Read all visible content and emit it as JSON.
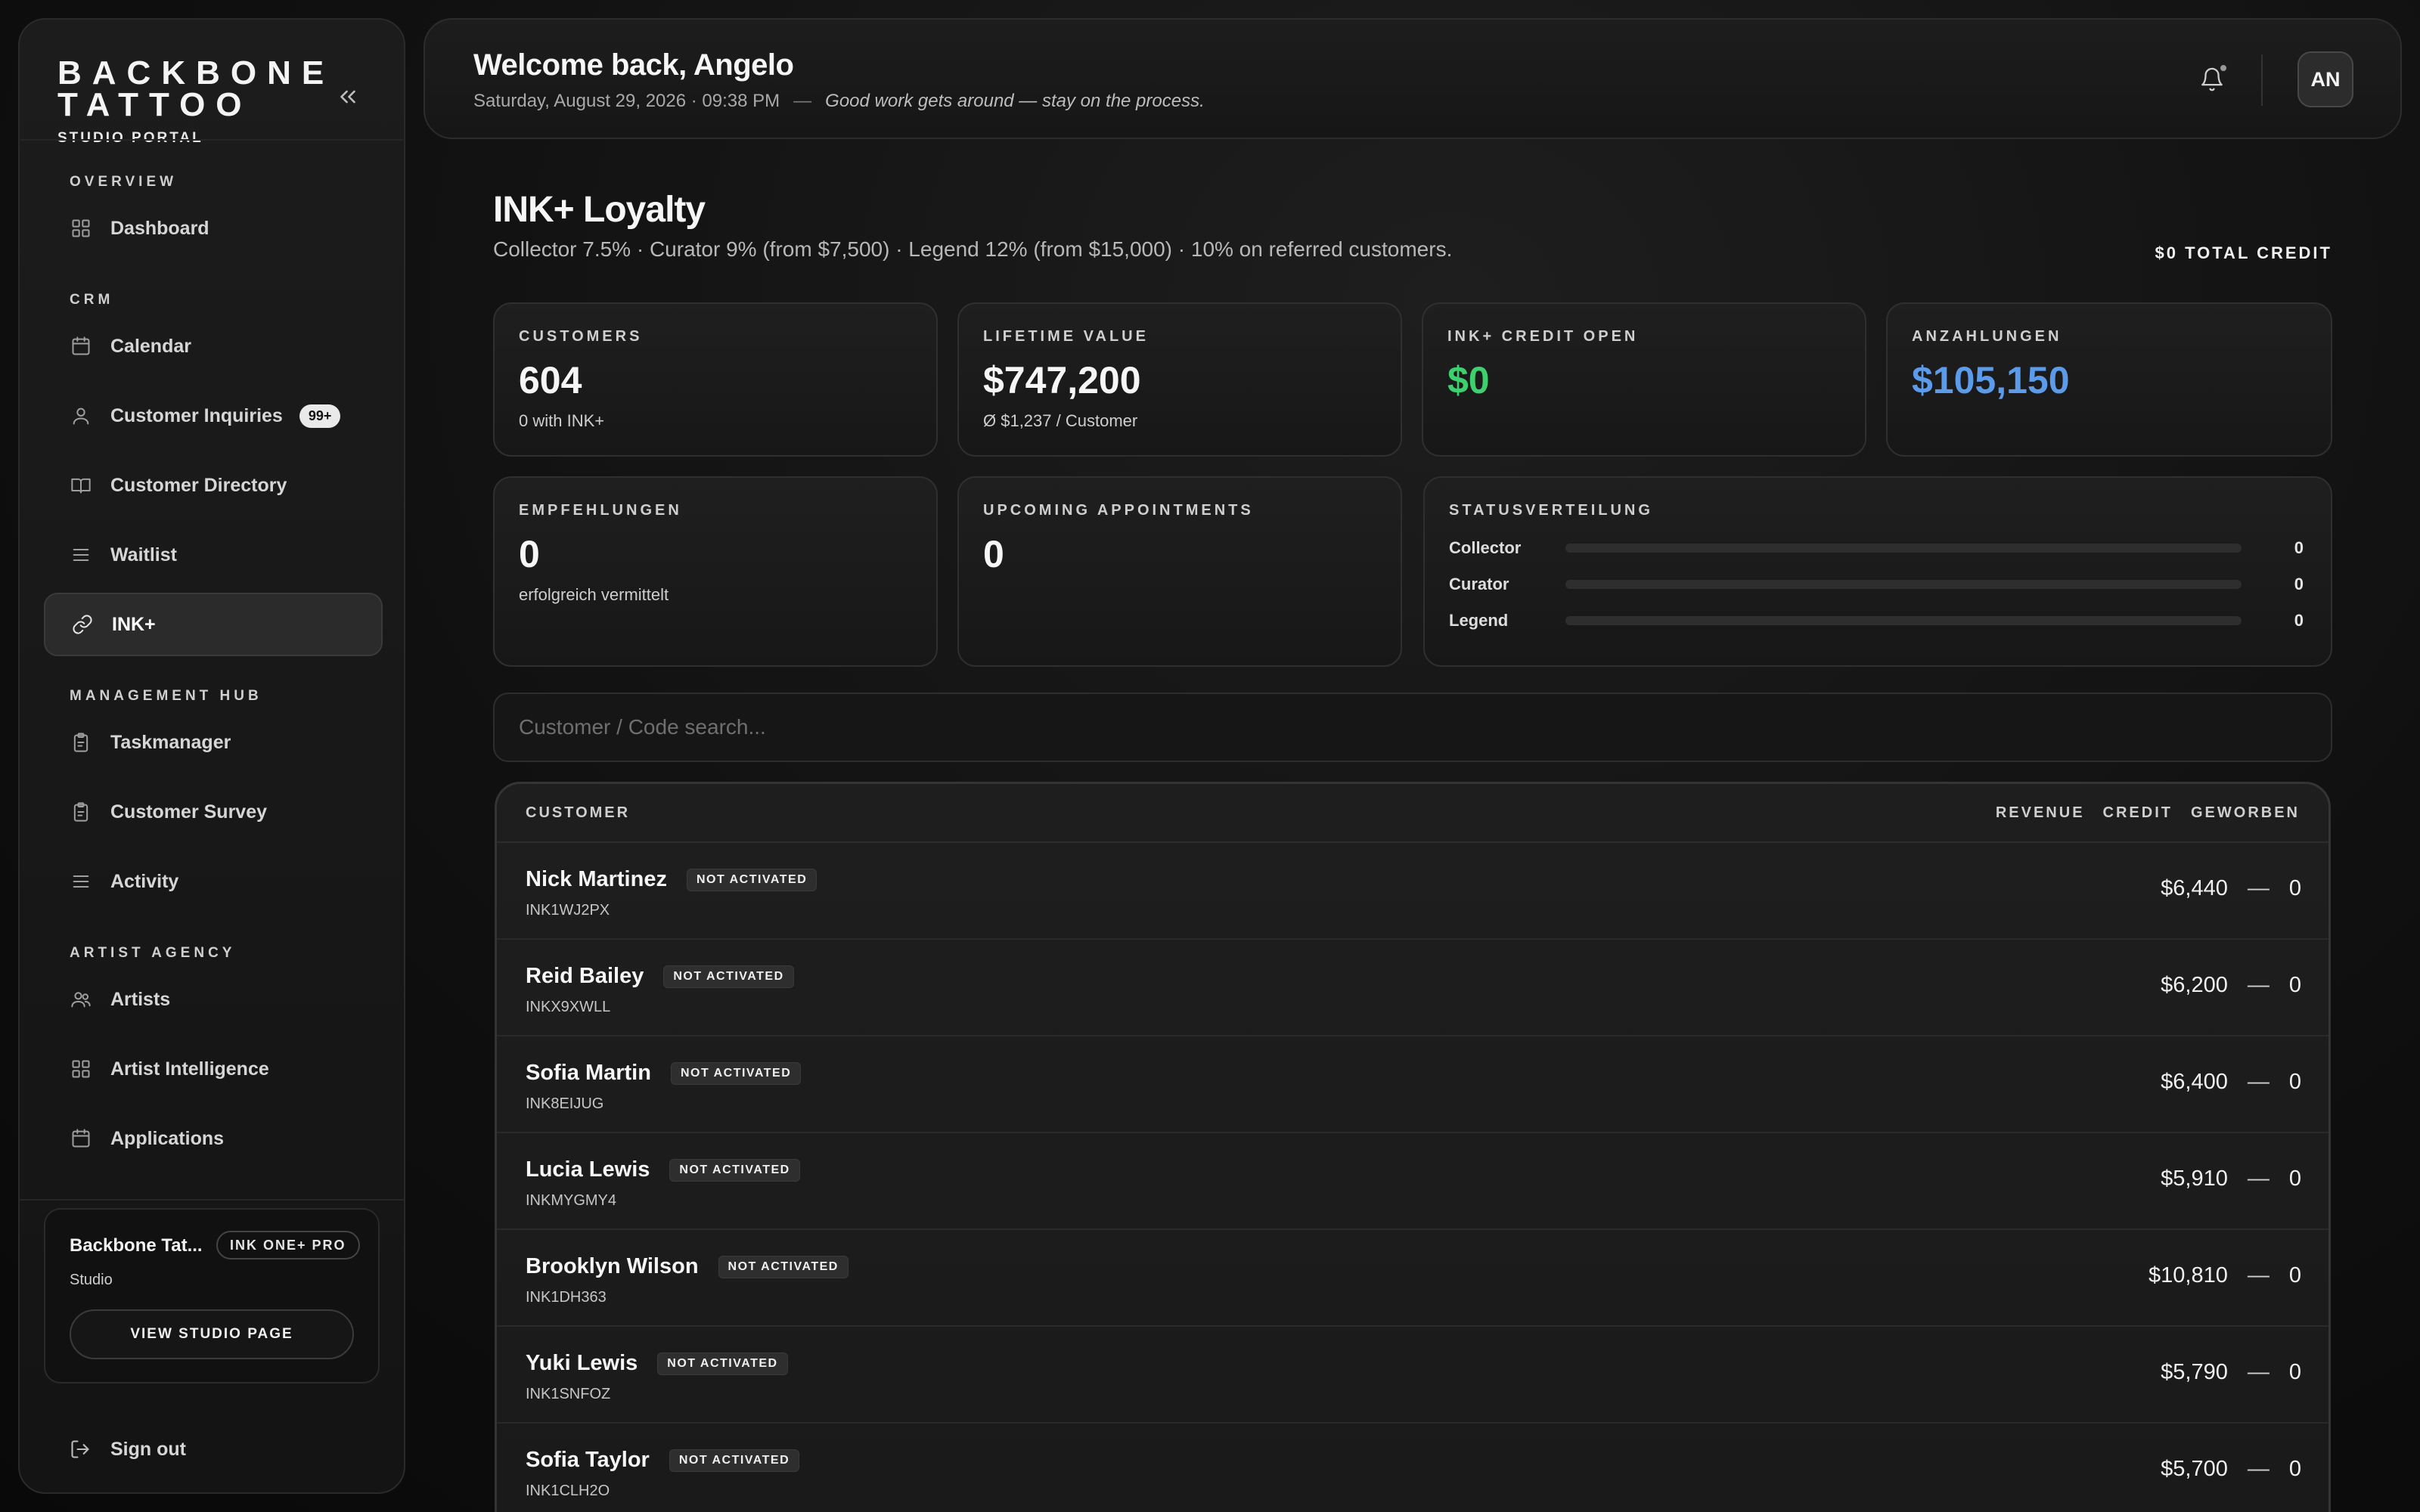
{
  "brand": {
    "line1": "BACKBONE",
    "line2": "TATTOO",
    "subtitle": "STUDIO PORTAL"
  },
  "sidebar": {
    "sections": [
      {
        "title": "OVERVIEW",
        "items": [
          {
            "label": "Dashboard",
            "icon": "grid-icon"
          }
        ]
      },
      {
        "title": "CRM",
        "items": [
          {
            "label": "Calendar",
            "icon": "calendar-icon"
          },
          {
            "label": "Customer Inquiries",
            "icon": "user-icon",
            "badge": "99+"
          },
          {
            "label": "Customer Directory",
            "icon": "book-icon"
          },
          {
            "label": "Waitlist",
            "icon": "list-icon"
          },
          {
            "label": "INK+",
            "icon": "link-icon",
            "active": true
          }
        ]
      },
      {
        "title": "MANAGEMENT HUB",
        "items": [
          {
            "label": "Taskmanager",
            "icon": "clipboard-icon"
          },
          {
            "label": "Customer Survey",
            "icon": "clipboard-icon"
          },
          {
            "label": "Activity",
            "icon": "list-icon"
          }
        ]
      },
      {
        "title": "ARTIST AGENCY",
        "items": [
          {
            "label": "Artists",
            "icon": "users-icon"
          },
          {
            "label": "Artist Intelligence",
            "icon": "grid-icon"
          },
          {
            "label": "Applications",
            "icon": "calendar-icon"
          }
        ]
      }
    ],
    "studio": {
      "name": "Backbone Tat...",
      "plan": "INK ONE+ PRO",
      "type": "Studio",
      "button": "VIEW STUDIO PAGE"
    },
    "signout": "Sign out"
  },
  "header": {
    "welcome": "Welcome back, Angelo",
    "datetime": "Saturday, August 29, 2026 · 09:38 PM",
    "separator": "—",
    "quote": "Good work gets around — stay on the process.",
    "avatar": "AN"
  },
  "main": {
    "title": "INK+ Loyalty",
    "description": "Collector 7.5% · Curator 9% (from $7,500) · Legend 12% (from $15,000) · 10% on referred customers.",
    "total_credit": "$0 TOTAL CREDIT",
    "stats": [
      {
        "label": "CUSTOMERS",
        "value": "604",
        "sub": "0 with INK+"
      },
      {
        "label": "LIFETIME VALUE",
        "value": "$747,200",
        "sub": "Ø $1,237 / Customer"
      },
      {
        "label": "INK+ CREDIT OPEN",
        "value": "$0",
        "sub": "",
        "color": "#3ecf6e"
      },
      {
        "label": "ANZAHLUNGEN",
        "value": "$105,150",
        "sub": "",
        "color": "#5b9bea"
      },
      {
        "label": "EMPFEHLUNGEN",
        "value": "0",
        "sub": "erfolgreich vermittelt"
      },
      {
        "label": "UPCOMING APPOINTMENTS",
        "value": "0",
        "sub": ""
      }
    ],
    "status": {
      "label": "STATUSVERTEILUNG",
      "rows": [
        {
          "name": "Collector",
          "count": "0",
          "fraction": 0
        },
        {
          "name": "Curator",
          "count": "0",
          "fraction": 0
        },
        {
          "name": "Legend",
          "count": "0",
          "fraction": 0
        }
      ]
    },
    "search": {
      "placeholder": "Customer / Code search...",
      "value": ""
    },
    "table": {
      "columns": {
        "customer": "CUSTOMER",
        "revenue": "REVENUE",
        "credit": "CREDIT",
        "geworben": "GEWORBEN"
      },
      "rows": [
        {
          "name": "Nick Martinez",
          "status": "NOT ACTIVATED",
          "code": "INK1WJ2PX",
          "revenue": "$6,440",
          "credit": "—",
          "geworben": "0"
        },
        {
          "name": "Reid Bailey",
          "status": "NOT ACTIVATED",
          "code": "INKX9XWLL",
          "revenue": "$6,200",
          "credit": "—",
          "geworben": "0"
        },
        {
          "name": "Sofia Martin",
          "status": "NOT ACTIVATED",
          "code": "INK8EIJUG",
          "revenue": "$6,400",
          "credit": "—",
          "geworben": "0"
        },
        {
          "name": "Lucia Lewis",
          "status": "NOT ACTIVATED",
          "code": "INKMYGMY4",
          "revenue": "$5,910",
          "credit": "—",
          "geworben": "0"
        },
        {
          "name": "Brooklyn Wilson",
          "status": "NOT ACTIVATED",
          "code": "INK1DH363",
          "revenue": "$10,810",
          "credit": "—",
          "geworben": "0"
        },
        {
          "name": "Yuki Lewis",
          "status": "NOT ACTIVATED",
          "code": "INK1SNFOZ",
          "revenue": "$5,790",
          "credit": "—",
          "geworben": "0"
        },
        {
          "name": "Sofia Taylor",
          "status": "NOT ACTIVATED",
          "code": "INK1CLH2O",
          "revenue": "$5,700",
          "credit": "—",
          "geworben": "0"
        }
      ]
    }
  }
}
